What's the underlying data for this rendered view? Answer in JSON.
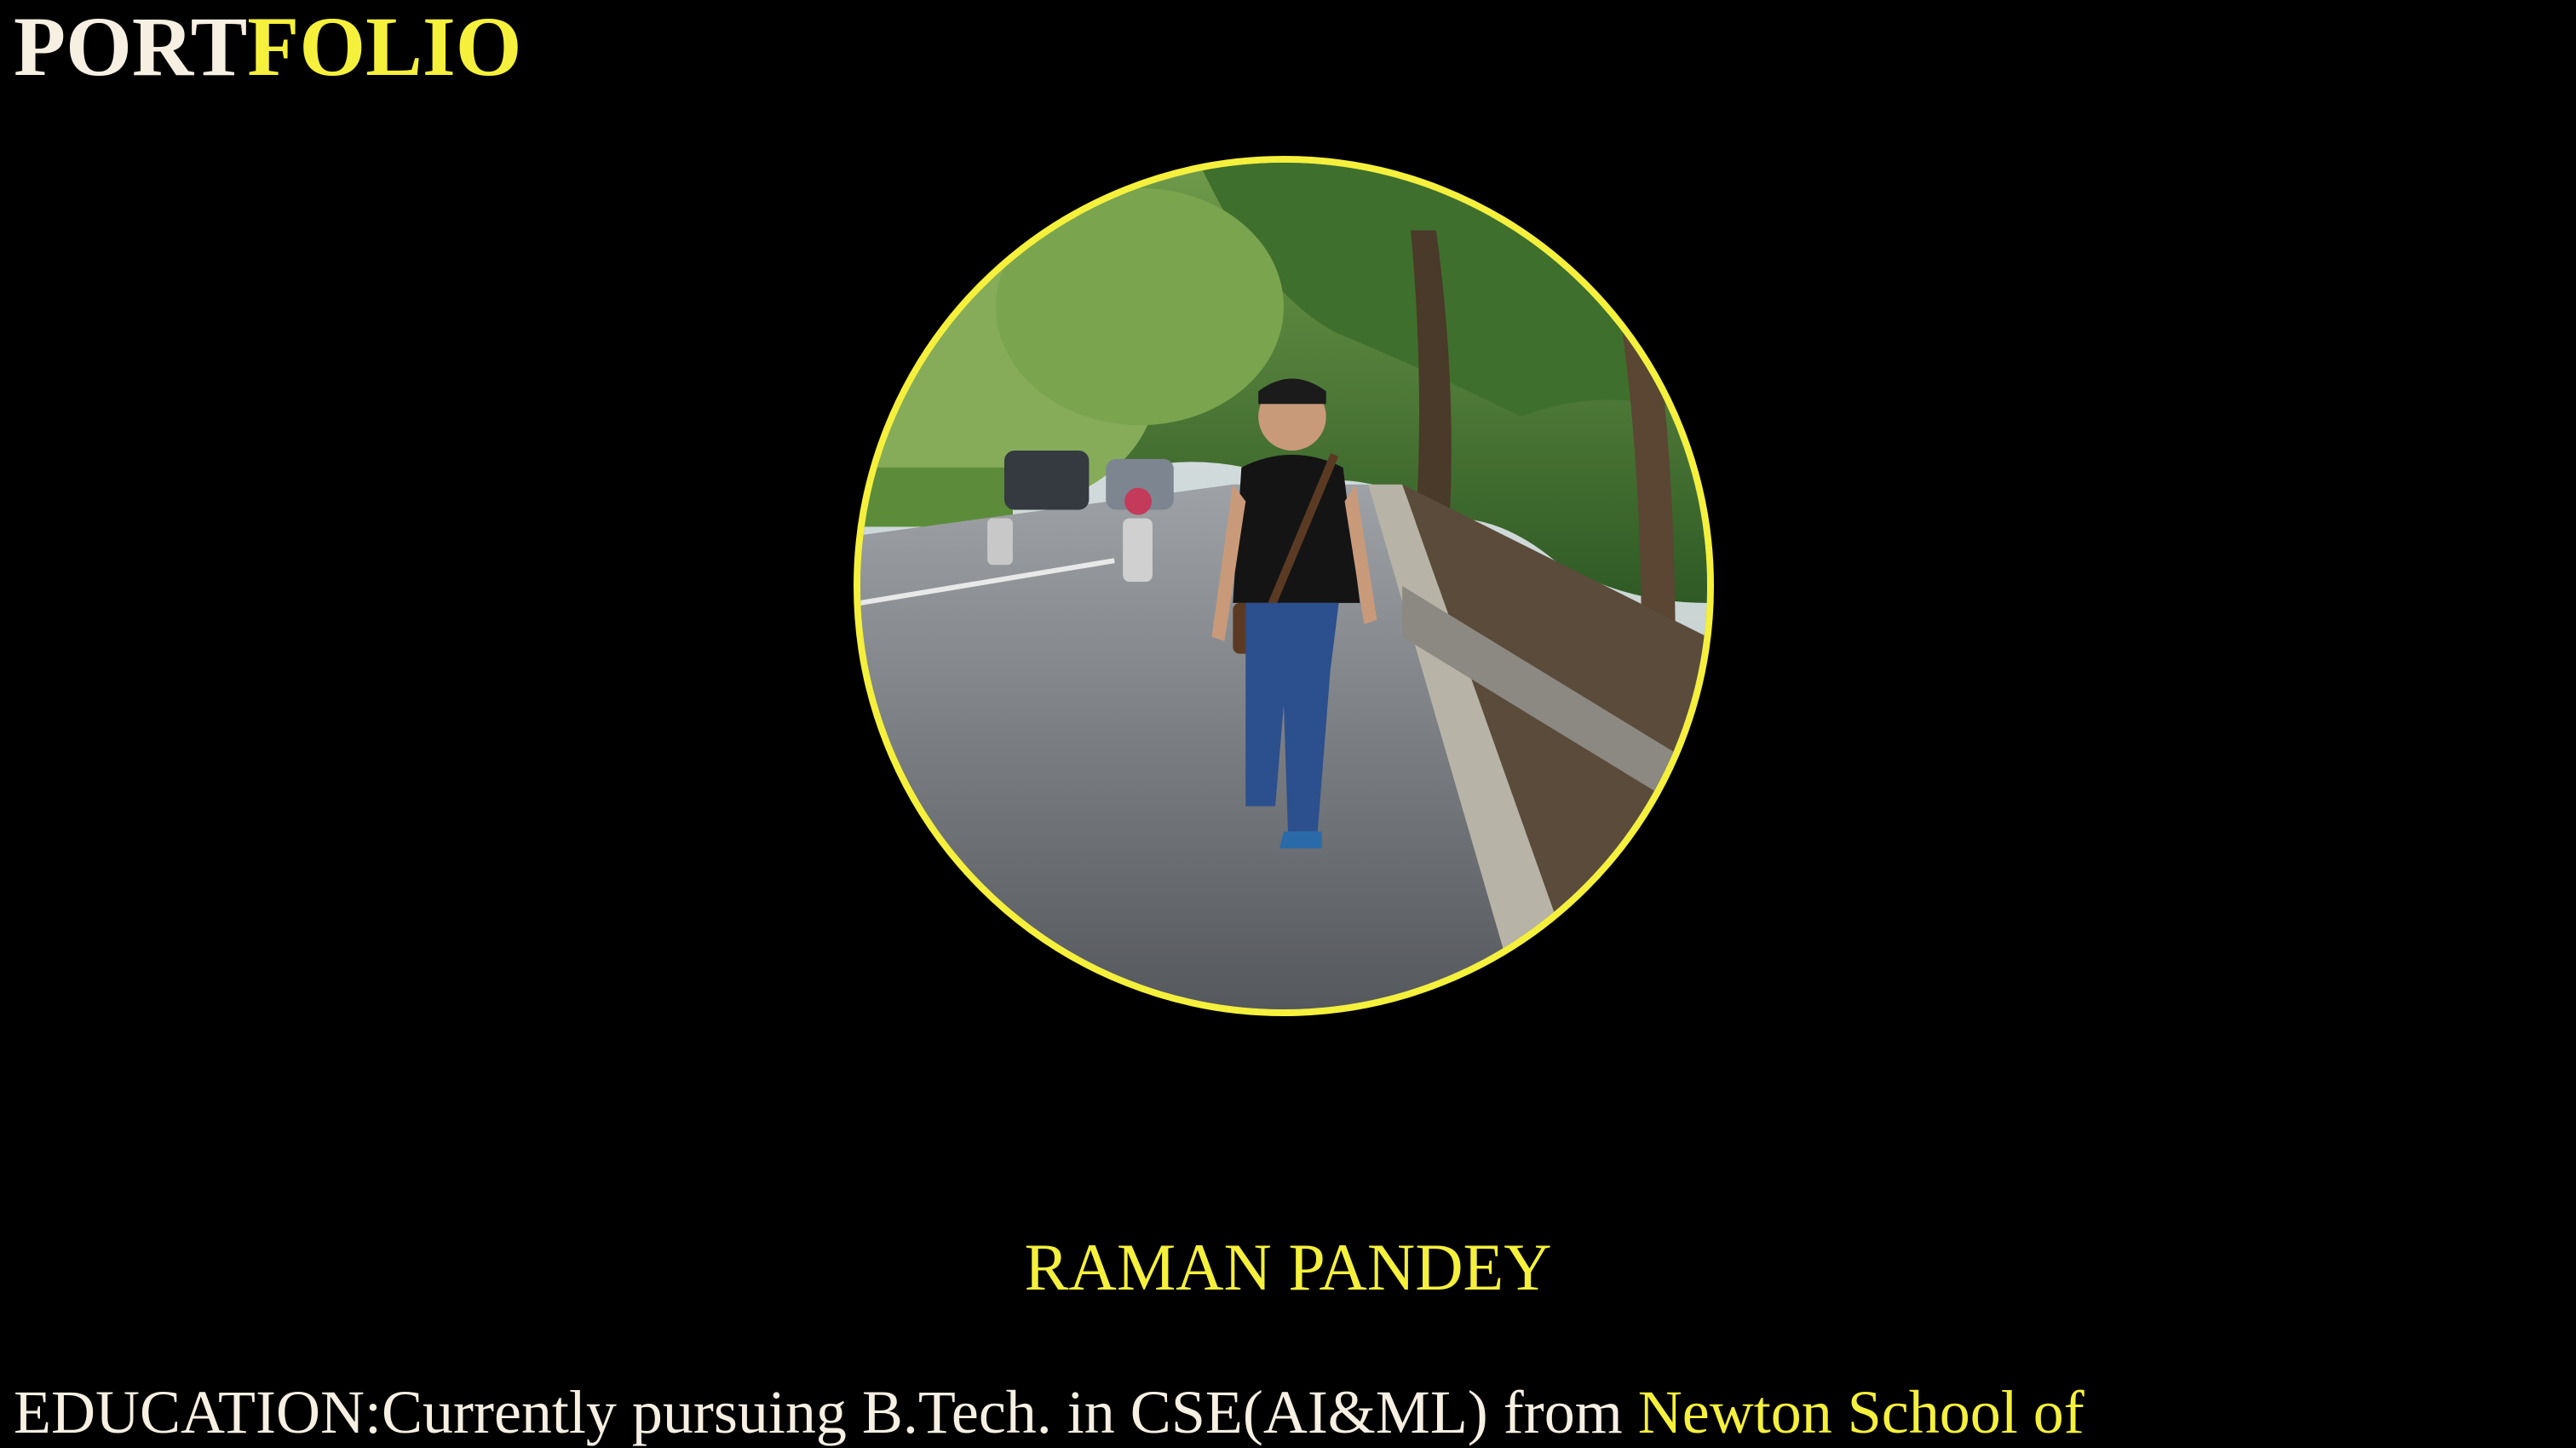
{
  "brand": {
    "part_a": "PORT",
    "part_b": "FOLIO"
  },
  "profile": {
    "name": "RAMAN PANDEY",
    "photo_alt": "Profile photo"
  },
  "education": {
    "label": "EDUCATION:",
    "text": "Currently pursuing B.Tech. in CSE(AI&ML) from ",
    "institution": "Newton School of"
  },
  "colors": {
    "background": "#000000",
    "accent": "#f5f03c",
    "text": "#f7efe2"
  }
}
